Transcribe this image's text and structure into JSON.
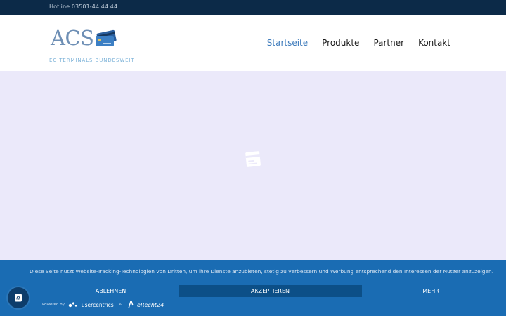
{
  "topbar": {
    "hotline": "Hotline 03501-44 44 44"
  },
  "header": {
    "logo_text": "ACS",
    "tagline": "EC TERMINALS BUNDESWEIT"
  },
  "nav": {
    "items": [
      {
        "label": "Startseite",
        "active": true
      },
      {
        "label": "Produkte",
        "active": false
      },
      {
        "label": "Partner",
        "active": false
      },
      {
        "label": "Kontakt",
        "active": false
      }
    ]
  },
  "consent": {
    "message": "Diese Seite nutzt Website-Tracking-Technologien von Dritten, um ihre Dienste anzubieten, stetig zu verbessern und Werbung entsprechend den Interessen der Nutzer anzuzeigen.",
    "decline_label": "ABLEHNEN",
    "accept_label": "AKZEPTIEREN",
    "more_label": "MEHR",
    "powered_by": "Powered by",
    "brand_uc": "usercentrics",
    "amp": "&",
    "brand_er": "eRecht24"
  },
  "icons": {
    "loader": "credit-card-icon",
    "fab": "fingerprint-icon"
  },
  "colors": {
    "topbar": "#0c2a48",
    "accent": "#3f7cbc",
    "consent_bg": "#1a6cb3",
    "accept_bg": "#0c4f87",
    "hero_bg": "#ebe9fa"
  }
}
